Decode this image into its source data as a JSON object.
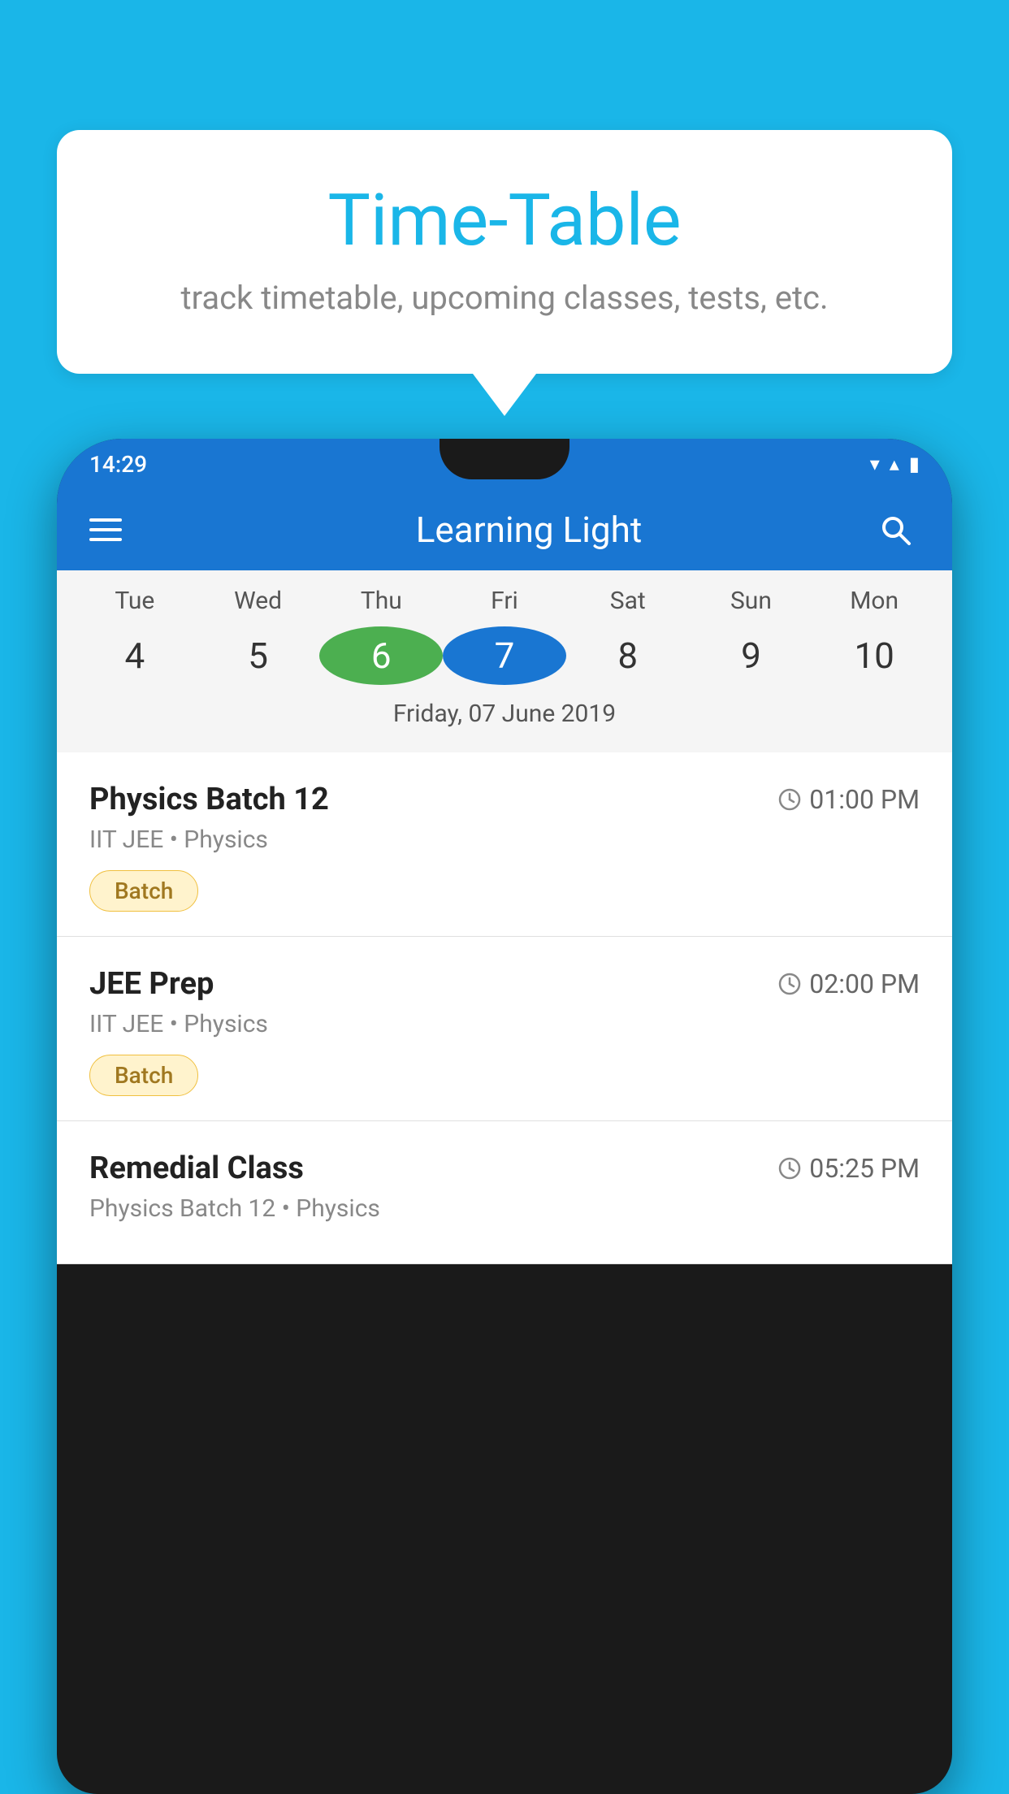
{
  "background_color": "#1ab6e8",
  "bubble": {
    "title": "Time-Table",
    "subtitle": "track timetable, upcoming classes, tests, etc."
  },
  "phone": {
    "status_bar": {
      "time": "14:29"
    },
    "app_bar": {
      "title": "Learning Light"
    },
    "calendar": {
      "days": [
        "Tue",
        "Wed",
        "Thu",
        "Fri",
        "Sat",
        "Sun",
        "Mon"
      ],
      "dates": [
        "4",
        "5",
        "6",
        "7",
        "8",
        "9",
        "10"
      ],
      "today_index": 2,
      "selected_index": 3,
      "selected_label": "Friday, 07 June 2019"
    },
    "classes": [
      {
        "name": "Physics Batch 12",
        "time": "01:00 PM",
        "meta": "IIT JEE • Physics",
        "badge": "Batch"
      },
      {
        "name": "JEE Prep",
        "time": "02:00 PM",
        "meta": "IIT JEE • Physics",
        "badge": "Batch"
      },
      {
        "name": "Remedial Class",
        "time": "05:25 PM",
        "meta": "Physics Batch 12 • Physics",
        "badge": null
      }
    ]
  },
  "icons": {
    "hamburger": "☰",
    "search": "🔍",
    "clock": "🕐",
    "wifi": "▼",
    "signal": "▲",
    "battery": "▮"
  }
}
